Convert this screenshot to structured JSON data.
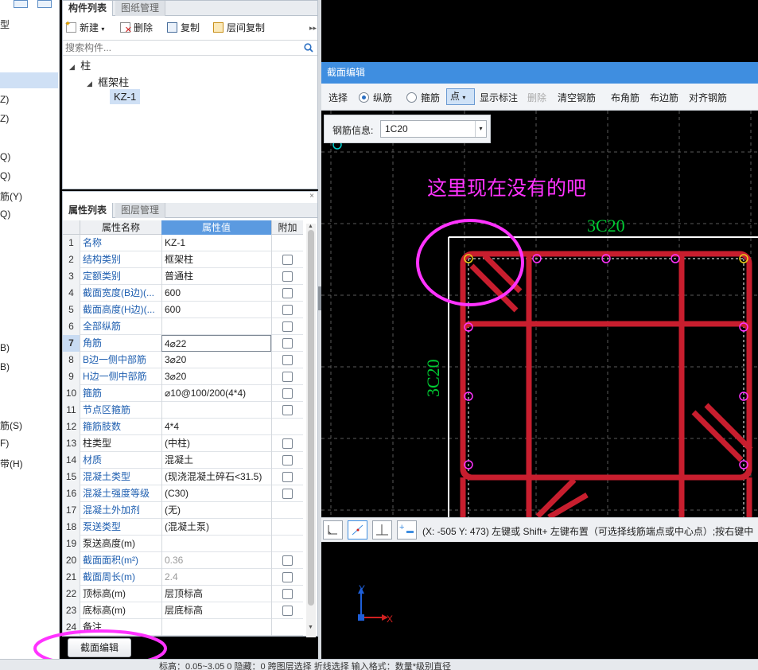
{
  "left_strip": {
    "items": [
      "型",
      "Z)",
      "Z)",
      "Q)",
      "Q)",
      "筋(Y)",
      "Q)",
      "B)",
      "B)",
      "筋(S)",
      "F)",
      "带(H)"
    ]
  },
  "component_panel": {
    "tabs": [
      "构件列表",
      "图纸管理"
    ],
    "toolbar": {
      "new": "新建",
      "delete": "删除",
      "copy": "复制",
      "floor_copy": "层间复制"
    },
    "search_placeholder": "搜索构件...",
    "tree": {
      "root": "柱",
      "child": "框架柱",
      "leaf": "KZ-1"
    }
  },
  "property_panel": {
    "tabs": [
      "属性列表",
      "图层管理"
    ],
    "headers": {
      "name": "属性名称",
      "value": "属性值",
      "add": "附加"
    },
    "rows": [
      {
        "n": "1",
        "name": "名称",
        "value": "KZ-1",
        "check": false,
        "blue": true
      },
      {
        "n": "2",
        "name": "结构类别",
        "value": "框架柱",
        "check": true,
        "blue": true
      },
      {
        "n": "3",
        "name": "定额类别",
        "value": "普通柱",
        "check": true,
        "blue": true
      },
      {
        "n": "4",
        "name": "截面宽度(B边)(...",
        "value": "600",
        "check": true,
        "blue": true
      },
      {
        "n": "5",
        "name": "截面高度(H边)(...",
        "value": "600",
        "check": true,
        "blue": true
      },
      {
        "n": "6",
        "name": "全部纵筋",
        "value": "",
        "check": true,
        "blue": true
      },
      {
        "n": "7",
        "name": "角筋",
        "value": "4⌀22",
        "check": true,
        "blue": true,
        "selected": true
      },
      {
        "n": "8",
        "name": "B边一侧中部筋",
        "value": "3⌀20",
        "check": true,
        "blue": true
      },
      {
        "n": "9",
        "name": "H边一侧中部筋",
        "value": "3⌀20",
        "check": true,
        "blue": true
      },
      {
        "n": "10",
        "name": "箍筋",
        "value": "⌀10@100/200(4*4)",
        "check": true,
        "blue": true
      },
      {
        "n": "11",
        "name": "节点区箍筋",
        "value": "",
        "check": true,
        "blue": true
      },
      {
        "n": "12",
        "name": "箍筋肢数",
        "value": "4*4",
        "check": false,
        "blue": true
      },
      {
        "n": "13",
        "name": "柱类型",
        "value": "(中柱)",
        "check": true,
        "blue": false
      },
      {
        "n": "14",
        "name": "材质",
        "value": "混凝土",
        "check": true,
        "blue": true
      },
      {
        "n": "15",
        "name": "混凝土类型",
        "value": "(现浇混凝土碎石<31.5)",
        "check": true,
        "blue": true
      },
      {
        "n": "16",
        "name": "混凝土强度等级",
        "value": "(C30)",
        "check": true,
        "blue": true
      },
      {
        "n": "17",
        "name": "混凝土外加剂",
        "value": "(无)",
        "check": false,
        "blue": true
      },
      {
        "n": "18",
        "name": "泵送类型",
        "value": "(混凝土泵)",
        "check": false,
        "blue": true
      },
      {
        "n": "19",
        "name": "泵送高度(m)",
        "value": "",
        "check": false,
        "blue": false
      },
      {
        "n": "20",
        "name": "截面面积(m²)",
        "value": "0.36",
        "check": true,
        "blue": true,
        "grey": true
      },
      {
        "n": "21",
        "name": "截面周长(m)",
        "value": "2.4",
        "check": true,
        "blue": true,
        "grey": true
      },
      {
        "n": "22",
        "name": "顶标高(m)",
        "value": "层顶标高",
        "check": true,
        "blue": false
      },
      {
        "n": "23",
        "name": "底标高(m)",
        "value": "层底标高",
        "check": true,
        "blue": false
      },
      {
        "n": "24",
        "name": "备注",
        "value": "",
        "check": false,
        "blue": false
      }
    ],
    "section_edit_button": "截面编辑"
  },
  "section_editor": {
    "title": "截面编辑",
    "toolbar": {
      "select": "选择",
      "longitudinal": "纵筋",
      "stirrup": "箍筋",
      "point": "点",
      "show_label": "显示标注",
      "delete": "删除",
      "clear": "清空钢筋",
      "corner": "布角筋",
      "edge": "布边筋",
      "align": "对齐钢筋"
    },
    "rebar_info_label": "钢筋信息:",
    "rebar_info_value": "1C20",
    "top_label": "3C20",
    "side_label": "3C20",
    "annotation": "这里现在没有的吧",
    "status_text": "(X: -505 Y: 473) 左键或 Shift+ 左键布置（可选择线筋端点或中心点）;按右键中",
    "axis_x": "X",
    "axis_y": "Y"
  },
  "colors": {
    "rebar": "#c81e2e",
    "highlight": "#ff33ff",
    "label": "#00cc33",
    "title_bar": "#3f8ee0"
  },
  "bottom_bar": {
    "text": "标高：0.05~3.05     0             隐藏：0   跨图层选择   折线选择   输入格式：数量*级别直径"
  }
}
